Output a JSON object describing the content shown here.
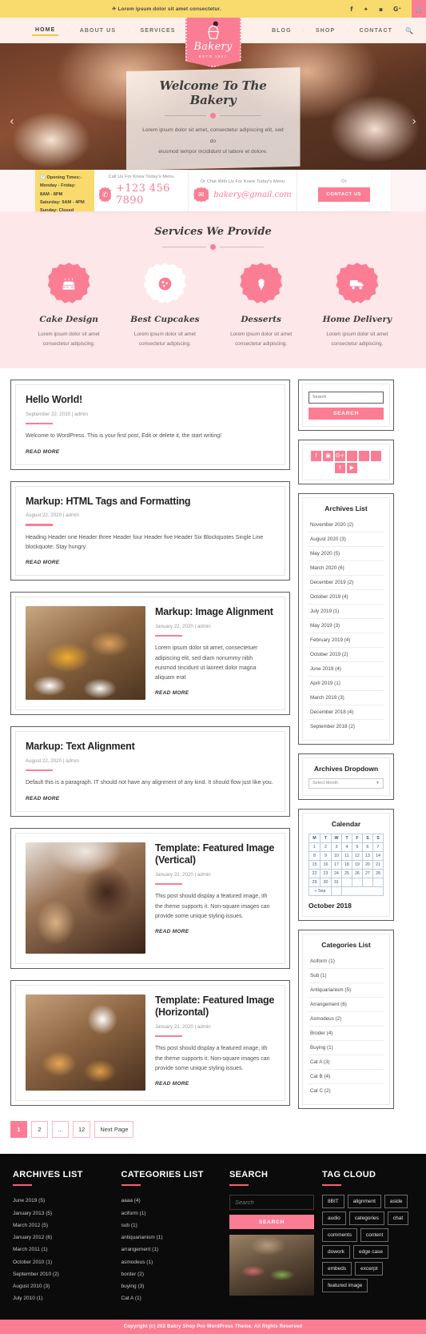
{
  "topbar": {
    "announcement": "Lorem ipsum dolor sit amet consectetur.",
    "social": [
      {
        "name": "facebook-icon",
        "glyph": "f"
      },
      {
        "name": "twitter-icon",
        "glyph": "🐦"
      },
      {
        "name": "youtube-icon",
        "glyph": "▶"
      },
      {
        "name": "google-plus-icon",
        "glyph": "G+"
      },
      {
        "name": "linkedin-icon",
        "glyph": "in"
      }
    ],
    "cart_glyph": "🛒"
  },
  "nav": {
    "left": [
      "HOME",
      "ABOUT US",
      "SERVICES"
    ],
    "right": [
      "BLOG",
      "SHOP",
      "CONTACT"
    ],
    "active": "HOME",
    "search_glyph": "🔍"
  },
  "logo": {
    "name": "Bakery",
    "established": "ESTD  1947"
  },
  "hero": {
    "title": "Welcome To The Bakery",
    "subtitle_line1": "Lorem ipsum dolor sit amet, consectetur adipiscing elit, sed do",
    "subtitle_line2": "eiusmod tempor incididunt ut labore et dolore.",
    "prev_glyph": "‹",
    "next_glyph": "›"
  },
  "contact_bar": {
    "hours_title": "Opening Times:-",
    "hours_lines": [
      "Monday - Friday:",
      "8AM - 8PM",
      "Saturday: 9AM - 4PM",
      "Sunday: Closed"
    ],
    "phone_label": "Call Us For Knew Today's Menu",
    "phone": "+123 456 7890",
    "email_label": "Or Chat With Us For Knew Today's Menu",
    "email": "bakery@gmail.com",
    "or_label": "Or",
    "cta": "CONTACT US",
    "phone_glyph": "✆",
    "mail_glyph": "✉"
  },
  "services": {
    "title": "Services We Provide",
    "items": [
      {
        "name": "Cake Design",
        "desc_line1": "Lorem ipsum dolor sit amet",
        "desc_line2": "consectetur adipiscing.",
        "icon": "cake-icon",
        "glyph": "🎂",
        "style": "solid"
      },
      {
        "name": "Best Cupcakes",
        "desc_line1": "Lorem ipsum dolor sit amet",
        "desc_line2": "consectetur adipiscing.",
        "icon": "cookie-icon",
        "glyph": "🍪",
        "style": "outline"
      },
      {
        "name": "Desserts",
        "desc_line1": "Lorem ipsum dolor sit amet",
        "desc_line2": "consectetur adipiscing.",
        "icon": "ice-cream-icon",
        "glyph": "🍦",
        "style": "solid"
      },
      {
        "name": "Home Delivery",
        "desc_line1": "Lorem ipsum dolor sit amet",
        "desc_line2": "consectetur adipiscing.",
        "icon": "delivery-truck-icon",
        "glyph": "🚚",
        "style": "solid"
      }
    ]
  },
  "posts": [
    {
      "title": "Hello World!",
      "meta": "September 22, 2020 | admin",
      "text": "Welcome to WordPress. This is your first post, Edit or delete it, the start writing!",
      "read_more": "READ MORE",
      "layout": "text"
    },
    {
      "title": "Markup: HTML Tags and Formatting",
      "meta": "August 22, 2020 | admin",
      "text": "Heading Header one Header three Header four Header five Header Six Blockquotes Single Line blockquote: Stay hungry.",
      "read_more": "READ MORE",
      "layout": "text"
    },
    {
      "title": "Markup: Image Alignment",
      "meta": "January 22, 2020 | admin",
      "text": "Lorem ipsum dolor sit amet, consectetuer adipiscing elit, sed diam nonummy nibh euismod tincidunt ut laoreet dolor magna aliquam erat",
      "read_more": "READ MORE",
      "layout": "image-left",
      "image": "pastry-display-photo"
    },
    {
      "title": "Markup: Text Alignment",
      "meta": "August 22, 2020 | admin",
      "text": "Default this is a paragraph. IT should not have any alignment of any kind. It should flow just like you.",
      "read_more": "READ MORE",
      "layout": "text"
    },
    {
      "title": "Template: Featured Image (Vertical)",
      "meta": "January 22, 2020 | admin",
      "text": "This post should display a featured image, ith the theme supports it. Non-square images can provide some unique styling issues.",
      "read_more": "READ MORE",
      "layout": "image-left",
      "image": "muffin-brownie-photo"
    },
    {
      "title": "Template: Featured Image (Horizontal)",
      "meta": "January 22, 2020 | admin",
      "text": "This post should display a featured image, ith the theme supports it. Non-square images can provide some unique styling issues.",
      "read_more": "READ MORE",
      "layout": "image-left",
      "image": "cinnamon-roll-tea-photo"
    }
  ],
  "pagination": {
    "pages": [
      "1",
      "2",
      "...",
      "12",
      "Next Page"
    ],
    "current": "1"
  },
  "sidebar": {
    "search": {
      "placeholder": "Search",
      "button": "SEARCH"
    },
    "social": [
      {
        "name": "facebook-icon",
        "glyph": "f"
      },
      {
        "name": "instagram-icon",
        "glyph": "▣"
      },
      {
        "name": "google-plus-icon",
        "glyph": "G+"
      },
      {
        "name": "blank-icon-1",
        "glyph": ""
      },
      {
        "name": "blank-icon-2",
        "glyph": ""
      },
      {
        "name": "blank-icon-3",
        "glyph": ""
      },
      {
        "name": "tumblr-icon",
        "glyph": "t"
      },
      {
        "name": "youtube-icon",
        "glyph": "▶"
      }
    ],
    "archives": {
      "title": "Archives List",
      "items": [
        "November 2020 (2)",
        "August 2020 (3)",
        "May 2020 (5)",
        "March 2020 (6)",
        "December 2019 (2)",
        "October 2019 (4)",
        "July 2019 (1)",
        "May 2019 (3)",
        "February 2019 (4)",
        "October 2019 (2)",
        "June 2019 (4)",
        "April 2019 (1)",
        "March 2019 (3)",
        "December 2018 (4)",
        "September 2018 (2)"
      ]
    },
    "dropdown": {
      "title": "Archives Dropdown",
      "selected": "Select Month",
      "chevron": "▼"
    },
    "calendar": {
      "title": "Calendar",
      "weekdays": [
        "M",
        "T",
        "W",
        "T",
        "F",
        "S",
        "S"
      ],
      "weeks": [
        [
          "1",
          "2",
          "3",
          "4",
          "5",
          "6",
          "7"
        ],
        [
          "8",
          "9",
          "10",
          "11",
          "12",
          "13",
          "14"
        ],
        [
          "15",
          "16",
          "17",
          "18",
          "19",
          "20",
          "21"
        ],
        [
          "22",
          "23",
          "24",
          "25",
          "26",
          "27",
          "28"
        ],
        [
          "29",
          "30",
          "31",
          "",
          "",
          "",
          ""
        ]
      ],
      "prev_label": "« Sep",
      "month_label": "October 2018"
    },
    "categories": {
      "title": "Categories List",
      "items": [
        "Aciform (1)",
        "Sub (1)",
        "Antiquarianism (5)",
        "Arrangement (6)",
        "Asmodeus (2)",
        "Broder (4)",
        "Buying (1)",
        "Cat A (3)",
        "Cat B (4)",
        "Cat C (2)"
      ]
    }
  },
  "footer": {
    "archives": {
      "title": "ARCHIVES LIST",
      "items": [
        "June 2019 (5)",
        "January  2013 (5)",
        "March 2012 (5)",
        "January  2012 (6)",
        "March  2011 (1)",
        "October 2010 (1)",
        "September 2010 (2)",
        "August 2010 (3)",
        "July 2010 (1)"
      ]
    },
    "categories": {
      "title": "CATEGORIES LIST",
      "items": [
        "aaaa (4)",
        "aciform (1)",
        "sub (1)",
        "antiquarianism (1)",
        "arrangement (1)",
        "asmodeus (1)",
        "border (2)",
        "buying (3)",
        "Cat A (1)"
      ]
    },
    "search": {
      "title": "SEARCH",
      "placeholder": "Search",
      "button": "SEARCH",
      "image": "bakery-display-photo"
    },
    "tags": {
      "title": "TAG CLOUD",
      "items": [
        "8BIT",
        "alignment",
        "aside",
        "audio",
        "categories",
        "chat",
        "comments",
        "content",
        "dowork",
        "edge case",
        "embeds",
        "excerpt",
        "featured image"
      ]
    },
    "copyright": "Copyright (c) 202 Bakry Shop Pro WordPress Theme. All Rights Reserved"
  },
  "colors": {
    "pink": "#fb7d94",
    "yellow": "#f9db6d",
    "dark": "#0b0b0b",
    "light_pink": "#fde7e8"
  }
}
